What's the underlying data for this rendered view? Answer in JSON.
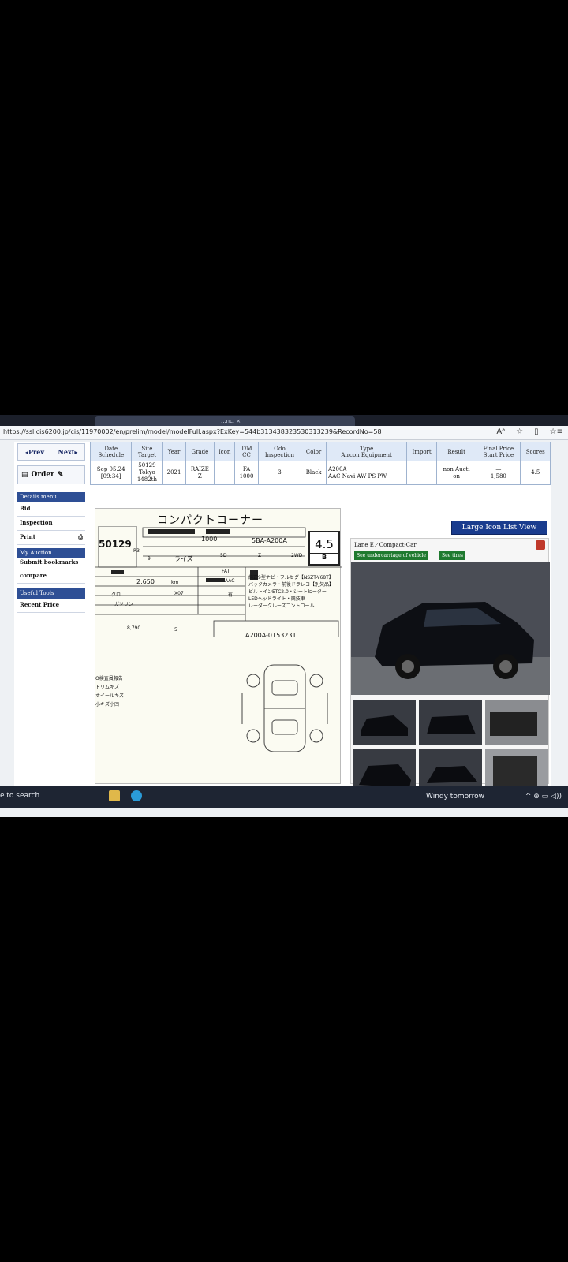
{
  "browser": {
    "url": "https://ssl.cis6200.jp/cis/11970002/en/prelim/model/modelFull.aspx?ExKey=544b313438323530313239&RecordNo=58",
    "tab_title": "...nc. ×"
  },
  "nav": {
    "prev": "◂Prev",
    "next": "Next▸",
    "order": "Order"
  },
  "lot_table": {
    "headers": [
      "Date\nSchedule",
      "Site\nTarget",
      "Year",
      "Grade",
      "Icon",
      "T/M\nCC",
      "Odo\nInspection",
      "Color",
      "Type\nAircon Equipment",
      "Import",
      "Result",
      "Final Price\nStart Price",
      "Scores"
    ],
    "row": {
      "date": "Sep 05.24",
      "time": "[09:34]",
      "lot": "50129",
      "site": "Tokyo",
      "target": "1482th",
      "year": "2021",
      "grade_model": "RAIZE",
      "grade": "Z",
      "tm": "FA",
      "cc": "1000",
      "inspection": "3",
      "color": "Black",
      "type": "A200A",
      "equipment": "AAC Navi AW PS PW",
      "import": "",
      "result": "non Aucti",
      "result2": "on",
      "final_price": "—",
      "start_price": "1,580",
      "score": "4.5"
    }
  },
  "sidebar": {
    "details_menu": "Details menu",
    "bid": "Bid",
    "inspection": "Inspection",
    "print": "Print",
    "my_auction": "My Auction",
    "submit_bookmarks": "Submit bookmarks",
    "compare": "compare",
    "useful_tools": "Useful Tools",
    "recent_price": "Recent Price"
  },
  "sheet": {
    "title": "コンパクトコーナー",
    "lot_no": "50129",
    "cc": "1000",
    "model_code": "5BA-A200A",
    "score": "4.5",
    "interior": "B",
    "year": "R3",
    "month": "9",
    "name": "ライズ",
    "doors": "5D",
    "grade": "Z",
    "drive": "2WD",
    "shift": "FAT",
    "ac": "AAC",
    "mileage": "2,650",
    "km": "km",
    "color": "クロ",
    "color_code": "X07",
    "fuel": "ガソリン",
    "equip_mark": "有",
    "recycle": "8,790",
    "seats": "5",
    "chassis": "A200A-0153231",
    "sales_points": [
      "純正9型ナビ・フルセグ【NSZT-Y68T】",
      "バックカメラ・前後ドラレコ【別欠品】",
      "ビルトインETC2.0・シートヒーター",
      "LEDヘッドライト・競技車",
      "レーダークルーズコントロール"
    ],
    "notes": [
      "O検査員報告",
      "トリムキズ",
      "ホイールキズ",
      "小キズ小凹"
    ]
  },
  "right_panel": {
    "large_icon_btn": "Large Icon List View",
    "lane": "Lane E／Compact-Car",
    "undercarriage_btn": "See undercarriage of vehicle",
    "tires_btn": "See tires"
  },
  "taskbar": {
    "search": "e to search",
    "weather": "Windy tomorrow",
    "tray": "^ ⊕ ▭ ◁))"
  }
}
